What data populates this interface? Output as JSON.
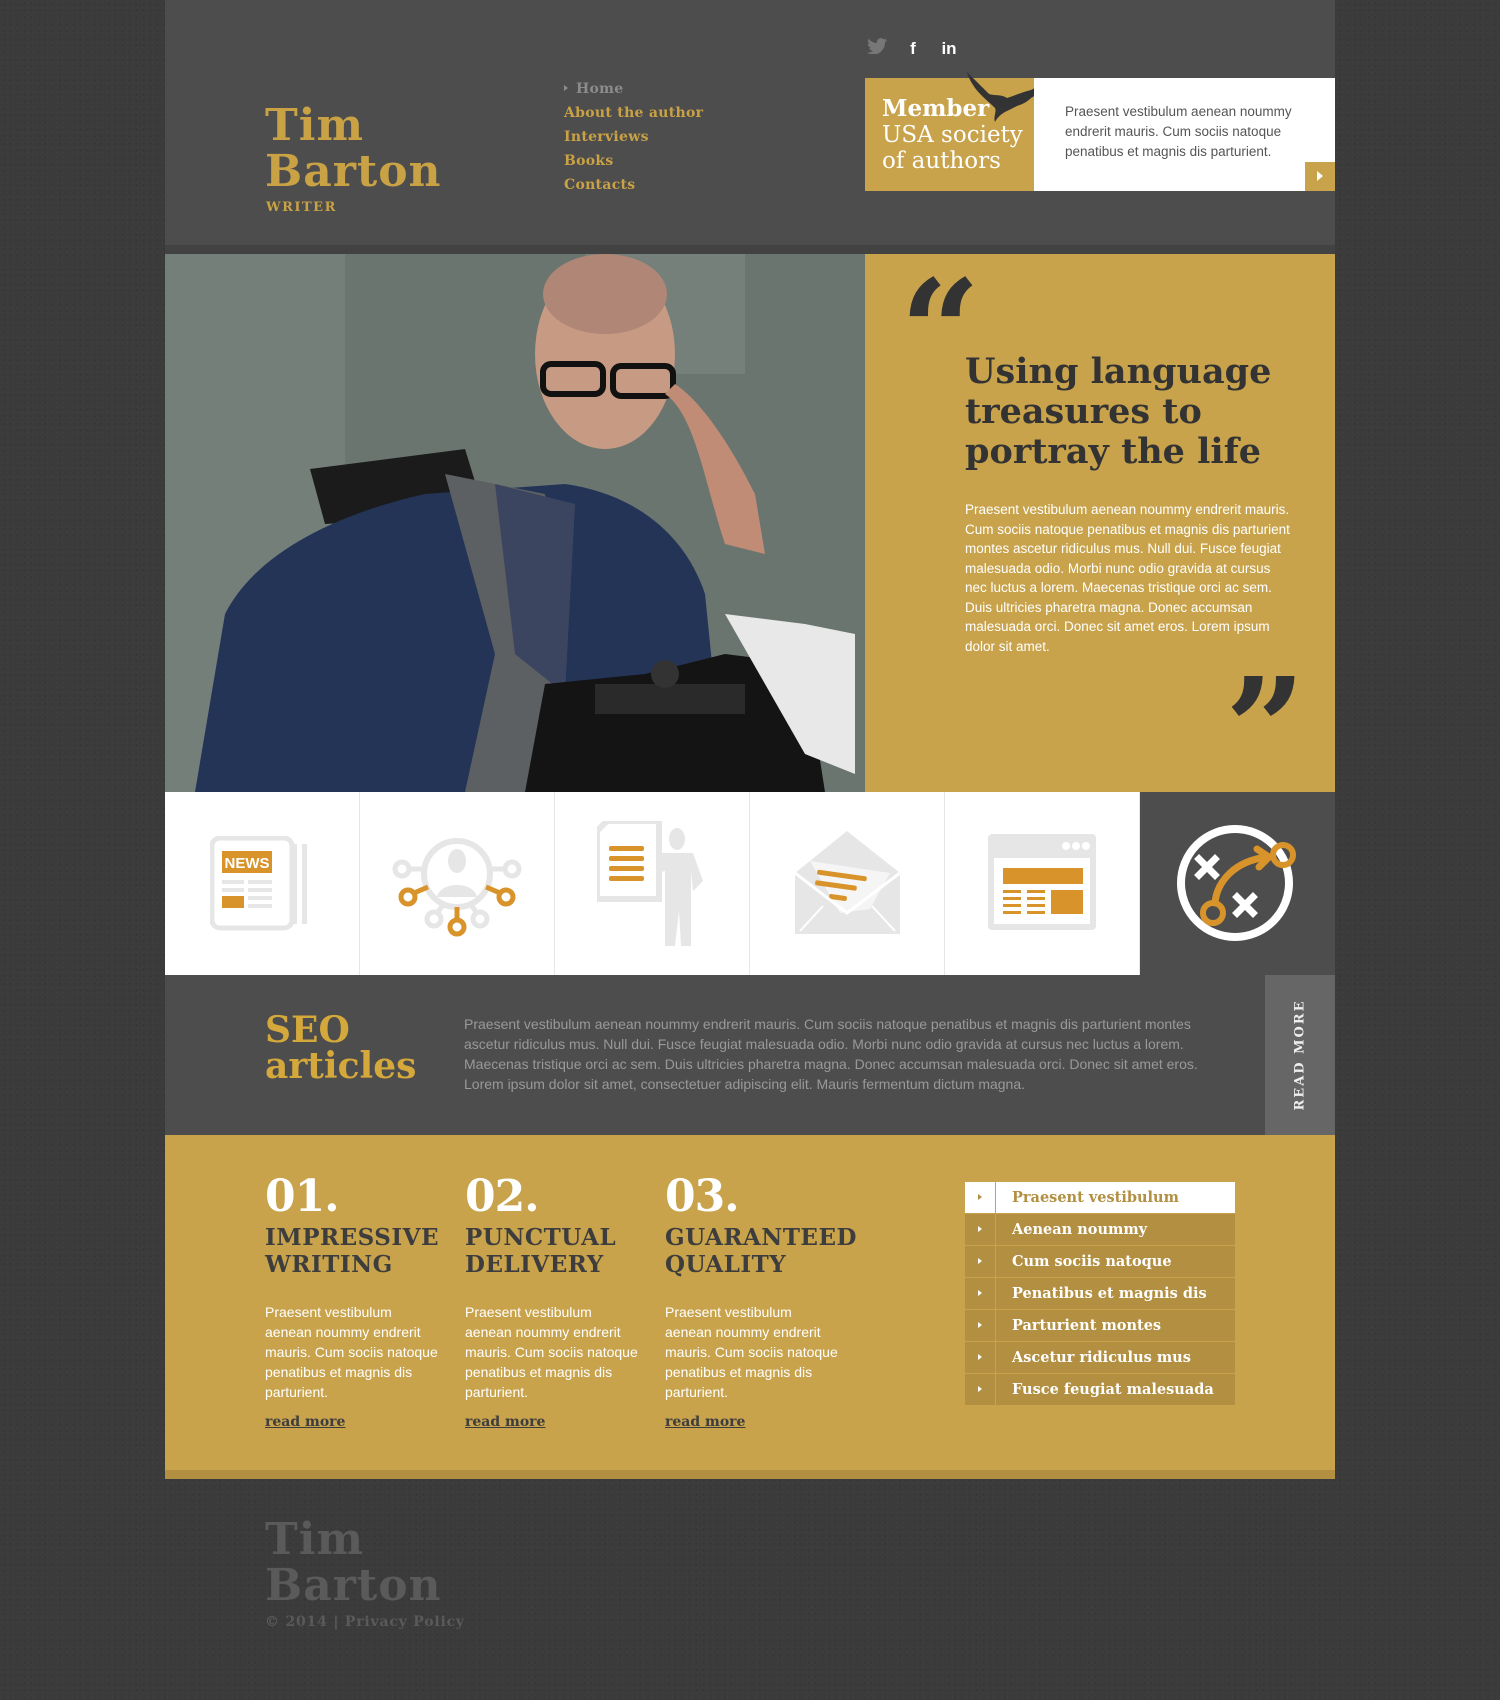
{
  "brand": {
    "name_line1": "Tim",
    "name_line2": "Barton",
    "role": "WRITER"
  },
  "nav": [
    {
      "label": "Home",
      "active": true
    },
    {
      "label": "About the author"
    },
    {
      "label": "Interviews"
    },
    {
      "label": "Books"
    },
    {
      "label": "Contacts"
    }
  ],
  "social": [
    {
      "icon": "twitter-icon",
      "glyph": "🐦"
    },
    {
      "icon": "facebook-icon",
      "glyph": "f"
    },
    {
      "icon": "linkedin-icon",
      "glyph": "in"
    }
  ],
  "member": {
    "title": "Member",
    "subtitle_line1": "USA society",
    "subtitle_line2": "of authors",
    "text": "Praesent vestibulum aenean noummy endrerit mauris. Cum sociis natoque penatibus et magnis dis parturient."
  },
  "hero": {
    "quote_title": "Using language treasures to portray the life",
    "quote_text": "Praesent vestibulum aenean noummy endrerit mauris. Cum sociis natoque penatibus et magnis dis parturient montes ascetur ridiculus mus. Null dui. Fusce feugiat malesuada odio. Morbi nunc odio gravida at cursus nec luctus a lorem. Maecenas tristique orci ac sem. Duis ultricies pharetra magna. Donec accumsan malesuada orci. Donec sit amet eros. Lorem ipsum dolor sit amet.",
    "open_quote": "“",
    "close_quote": "”"
  },
  "icons": [
    {
      "name": "news-icon",
      "label": "NEWS"
    },
    {
      "name": "network-icon"
    },
    {
      "name": "presentation-icon"
    },
    {
      "name": "mail-icon"
    },
    {
      "name": "webpage-icon"
    },
    {
      "name": "strategy-icon",
      "active": true
    }
  ],
  "seo": {
    "title_line1": "SEO",
    "title_line2": "articles",
    "text": "Praesent vestibulum aenean noummy endrerit mauris. Cum sociis natoque penatibus et magnis dis parturient montes ascetur ridiculus mus. Null dui. Fusce feugiat malesuada odio. Morbi nunc odio gravida at cursus nec luctus a lorem. Maecenas tristique orci ac sem. Duis ultricies pharetra magna. Donec accumsan malesuada orci. Donec sit amet eros. Lorem ipsum dolor sit amet, consectetuer adipiscing elit. Mauris fermentum dictum magna.",
    "button": "READ MORE"
  },
  "features": [
    {
      "num": "01.",
      "title_line1": "IMPRESSIVE",
      "title_line2": "WRITING",
      "text": "Praesent vestibulum aenean noummy endrerit mauris. Cum sociis natoque penatibus et magnis dis parturient.",
      "link": "read more"
    },
    {
      "num": "02.",
      "title_line1": "PUNCTUAL",
      "title_line2": "DELIVERY",
      "text": "Praesent vestibulum aenean noummy endrerit mauris. Cum sociis natoque penatibus et magnis dis parturient.",
      "link": "read more"
    },
    {
      "num": "03.",
      "title_line1": "GUARANTEED",
      "title_line2": "QUALITY",
      "text": "Praesent vestibulum aenean noummy endrerit mauris. Cum sociis natoque penatibus et magnis dis parturient.",
      "link": "read more"
    }
  ],
  "list": [
    {
      "label": "Praesent vestibulum",
      "active": true
    },
    {
      "label": "Aenean noummy"
    },
    {
      "label": "Cum sociis natoque"
    },
    {
      "label": "Penatibus et magnis dis"
    },
    {
      "label": "Parturient montes"
    },
    {
      "label": "Ascetur ridiculus mus"
    },
    {
      "label": "Fusce feugiat malesuada"
    }
  ],
  "footer": {
    "name_line1": "Tim",
    "name_line2": "Barton",
    "copyright": "© 2014 |",
    "privacy": "Privacy Policy"
  },
  "colors": {
    "gold": "#c8a34b",
    "gold_dark": "#b28f41",
    "panel": "#4d4d4d",
    "background": "#3b3b3b",
    "icon_orange": "#d8942a"
  }
}
